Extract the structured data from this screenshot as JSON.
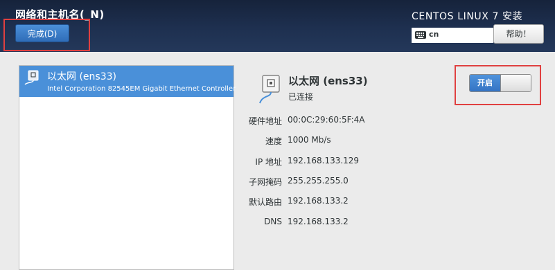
{
  "header": {
    "page_title": "网络和主机名(_N)",
    "done_label": "完成(D)",
    "product_title": "CENTOS LINUX 7 安装",
    "keyboard_layout": "cn",
    "help_label": "帮助！"
  },
  "connection_list": {
    "items": [
      {
        "name": "以太网 (ens33)",
        "description": "Intel Corporation 82545EM Gigabit Ethernet Controller",
        "icon": "network-wired-icon"
      }
    ]
  },
  "details": {
    "name": "以太网 (ens33)",
    "status": "已连接",
    "switch_label": "开启",
    "switch_on": true,
    "rows": [
      {
        "label": "硬件地址",
        "value": "00:0C:29:60:5F:4A"
      },
      {
        "label": "速度",
        "value": "1000 Mb/s"
      },
      {
        "label": "IP 地址",
        "value": "192.168.133.129"
      },
      {
        "label": "子网掩码",
        "value": "255.255.255.0"
      },
      {
        "label": "默认路由",
        "value": "192.168.133.2"
      },
      {
        "label": "DNS",
        "value": "192.168.133.2"
      }
    ]
  },
  "colors": {
    "header_bg": "#1e3050",
    "accent": "#4a90d9",
    "annotation": "#e04040"
  }
}
